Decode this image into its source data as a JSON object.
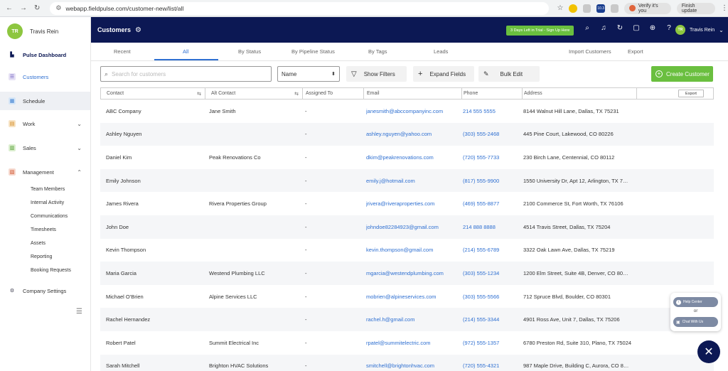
{
  "browser": {
    "url": "webapp.fieldpulse.com/customer-new/list/all",
    "profile_label": "Verify it's you",
    "update_label": "Finish update",
    "ext_badge": "10.3"
  },
  "sidebar": {
    "user_initials": "TR",
    "user_name": "Travis Rein",
    "items": [
      {
        "label": "Pulse Dashboard",
        "icon": "pulse-logo-icon"
      },
      {
        "label": "Customers",
        "icon": "customers-icon"
      },
      {
        "label": "Schedule",
        "icon": "calendar-icon"
      },
      {
        "label": "Work",
        "icon": "work-icon"
      },
      {
        "label": "Sales",
        "icon": "sales-icon"
      },
      {
        "label": "Management",
        "icon": "management-icon"
      },
      {
        "label": "Company Settings",
        "icon": "gear-icon"
      }
    ],
    "management_sub": [
      "Team Members",
      "Internal Activity",
      "Communications",
      "Timesheets",
      "Assets",
      "Reporting",
      "Booking Requests"
    ]
  },
  "header": {
    "title": "Customers",
    "trial_label": "3 Days Left in Trial - Sign Up Here",
    "user_initials": "TR",
    "user_name": "Travis Rein",
    "accent": "#0c1854"
  },
  "tabs": [
    "Recent",
    "All",
    "By Status",
    "By Pipeline Status",
    "By Tags",
    "Leads"
  ],
  "tab_actions": {
    "import": "Import Customers",
    "export": "Export"
  },
  "toolbar": {
    "search_placeholder": "Search for customers",
    "sort_value": "Name",
    "show_filters": "Show Filters",
    "expand_fields": "Expand Fields",
    "bulk_edit": "Bulk Edit",
    "create": "Create Customer",
    "create_color": "#6abf3f"
  },
  "table": {
    "columns": [
      "Contact",
      "Alt Contact",
      "Assigned To",
      "Email",
      "Phone",
      "Address"
    ],
    "export_label": "Export",
    "rows": [
      [
        "ABC Company",
        "Jane Smith",
        "-",
        "janesmith@abccompanyinc.com",
        "214 555 5555",
        "8144 Walnut Hill Lane, Dallas, TX 75231"
      ],
      [
        "Ashley Nguyen",
        "",
        "-",
        "ashley.nguyen@yahoo.com",
        "(303) 555-2468",
        "445 Pine Court, Lakewood, CO 80226"
      ],
      [
        "Daniel Kim",
        "Peak Renovations Co",
        "-",
        "dkim@peakrenovations.com",
        "(720) 555-7733",
        "230 Birch Lane, Centennial, CO 80112"
      ],
      [
        "Emily Johnson",
        "",
        "-",
        "emily.j@hotmail.com",
        "(817) 555-9900",
        "1550 University Dr, Apt 12, Arlington, TX 7…"
      ],
      [
        "James Rivera",
        "Rivera Properties Group",
        "-",
        "jrivera@riveraproperties.com",
        "(469) 555-8877",
        "2100 Commerce St, Fort Worth, TX 76106"
      ],
      [
        "John Doe",
        "",
        "-",
        "johndoe82284923@gmail.com",
        "214 888 8888",
        "4514 Travis Street, Dallas, TX 75204"
      ],
      [
        "Kevin Thompson",
        "",
        "-",
        "kevin.thompson@gmail.com",
        "(214) 555-6789",
        "3322 Oak Lawn Ave, Dallas, TX 75219"
      ],
      [
        "Maria Garcia",
        "Westend Plumbing LLC",
        "-",
        "mgarcia@westendplumbing.com",
        "(303) 555-1234",
        "1200 Elm Street, Suite 4B, Denver, CO 80…"
      ],
      [
        "Michael O'Brien",
        "Alpine Services LLC",
        "-",
        "mobrien@alpineservices.com",
        "(303) 555-5566",
        "712 Spruce Blvd, Boulder, CO 80301"
      ],
      [
        "Rachel Hernandez",
        "",
        "-",
        "rachel.h@gmail.com",
        "(214) 555-3344",
        "4901 Ross Ave, Unit 7, Dallas, TX 75206"
      ],
      [
        "Robert Patel",
        "Summit Electrical Inc",
        "-",
        "rpatel@summitelectric.com",
        "(972) 555-1357",
        "6780 Preston Rd, Suite 310, Plano, TX 75024"
      ],
      [
        "Sarah Mitchell",
        "Brighton HVAC Solutions",
        "-",
        "smitchell@brightonhvac.com",
        "(720) 555-4321",
        "987 Maple Drive, Building C, Aurora, CO 8…"
      ]
    ]
  },
  "help": {
    "help_center": "Help Center",
    "or": "or",
    "chat": "Chat With Us"
  }
}
